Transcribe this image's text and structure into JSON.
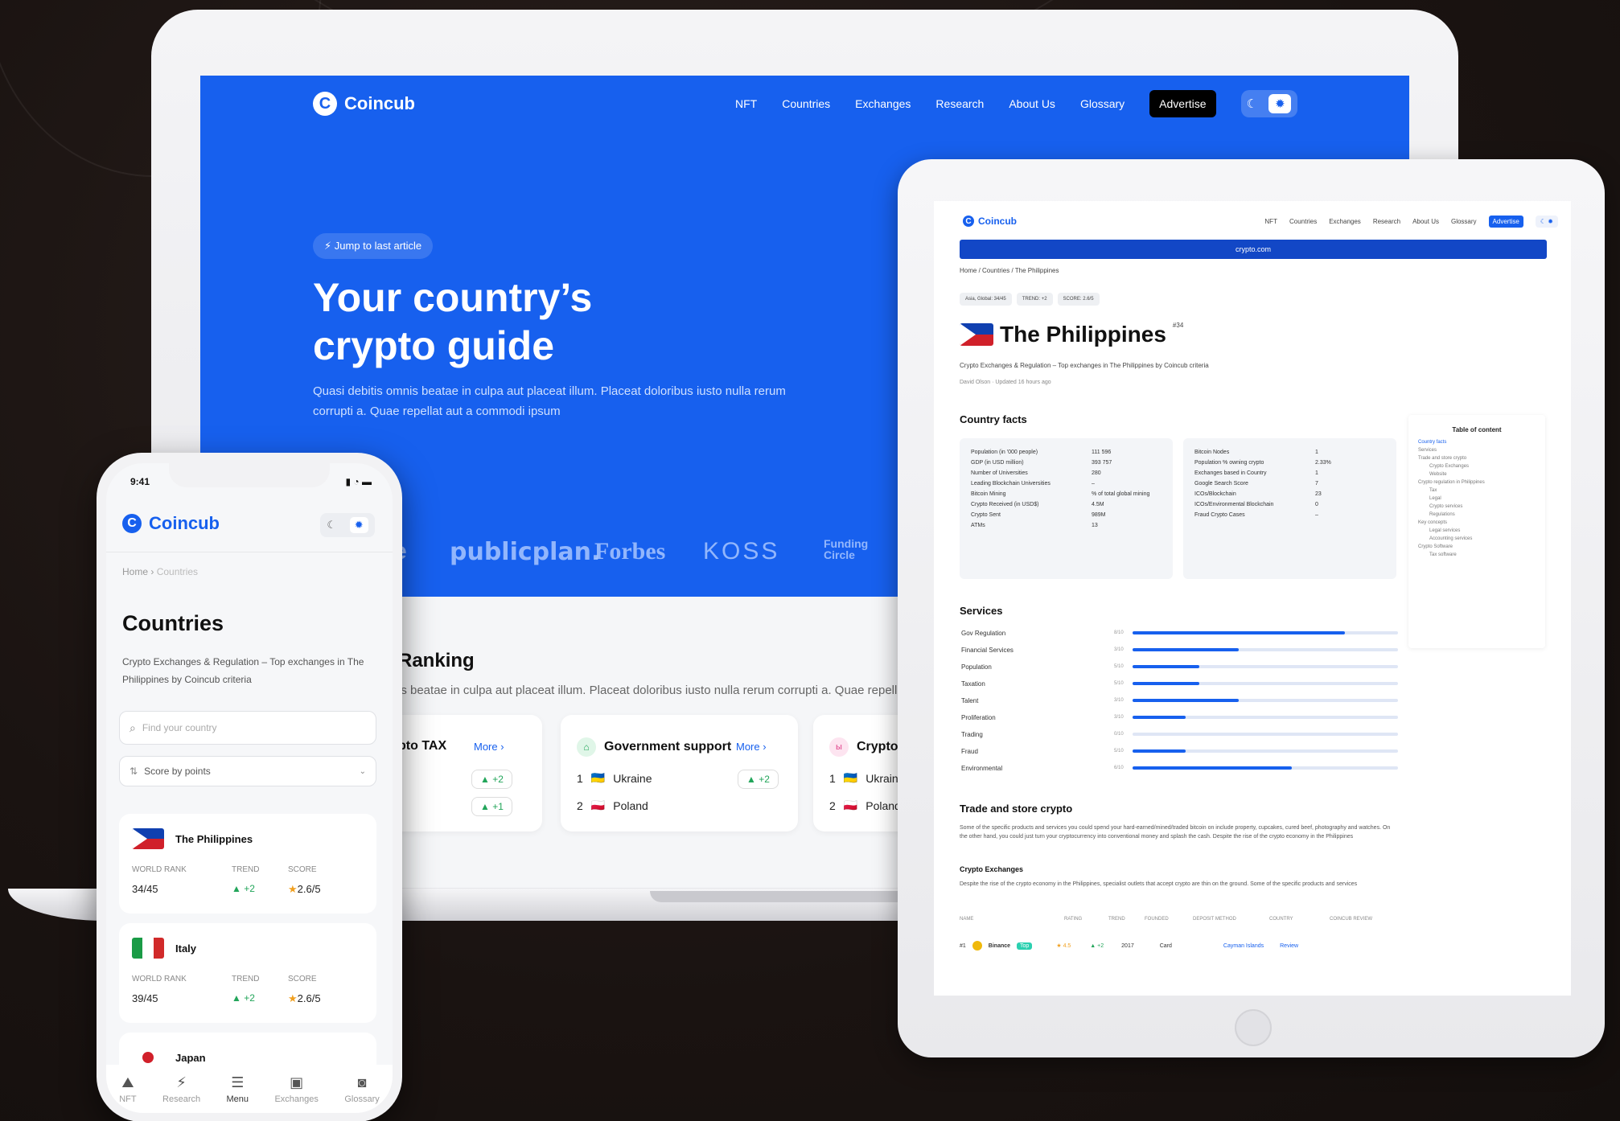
{
  "colors": {
    "brand_blue": "#1760ee",
    "background": "#1c1513",
    "up": "#22a55a",
    "star": "#f0a020"
  },
  "laptop": {
    "logo": "Coincub",
    "nav": [
      "NFT",
      "Countries",
      "Exchanges",
      "Research",
      "About Us",
      "Glossary"
    ],
    "advertise": "Advertise",
    "jump_chip": "Jump to last article",
    "headline": "Your country’s crypto guide",
    "lead": "Quasi debitis omnis beatae in culpa aut placeat illum. Placeat doloribus iusto nulla rerum corrupti a. Quae repellat aut a commodi ipsum",
    "brands": [
      "e",
      "publicplan.",
      "Forbes",
      "KOSS",
      "Funding Circle"
    ],
    "ranking_title": "Ranking",
    "ranking_sub": "is beatae in culpa aut placeat illum. Placeat doloribus iusto nulla rerum corrupti a. Quae repellat",
    "cards": [
      {
        "title": "pto TAX",
        "more": "More",
        "rows": [
          {
            "change": "+2"
          },
          {
            "change": "+1"
          }
        ]
      },
      {
        "title": "Government support",
        "more": "More",
        "rows": [
          {
            "rank": "1",
            "country": "Ukraine",
            "change": "+2"
          },
          {
            "rank": "2",
            "country": "Poland"
          }
        ]
      },
      {
        "title": "Crypto",
        "rows": [
          {
            "rank": "1",
            "country": "Ukrain"
          },
          {
            "rank": "2",
            "country": "Poland"
          }
        ]
      }
    ]
  },
  "tablet": {
    "logo": "Coincub",
    "nav": [
      "NFT",
      "Countries",
      "Exchanges",
      "Research",
      "About Us",
      "Glossary"
    ],
    "advertise": "Advertise",
    "banner": "crypto.com",
    "breadcrumb": "Home / Countries / The Philippines",
    "tags": [
      "Asia, Global: 34/45",
      "TREND: +2",
      "SCORE: 2.6/5"
    ],
    "title": "The Philippines",
    "rank": "#34",
    "subtitle": "Crypto Exchanges & Regulation – Top exchanges in The Philippines by Coincub criteria",
    "author": "David Olson · Updated 16 hours ago",
    "country_facts": "Country facts",
    "facts_left": [
      [
        "Population (in '000 people)",
        "111 596"
      ],
      [
        "GDP (in USD million)",
        "393 757"
      ],
      [
        "Number of Universities",
        "280"
      ],
      [
        "Leading Blockchain Universities",
        "–"
      ],
      [
        "Bitcoin Mining",
        "% of total global mining"
      ],
      [
        "Crypto Received (in USD$)",
        "4.5M"
      ],
      [
        "Crypto Sent",
        "989M"
      ],
      [
        "ATMs",
        "13"
      ]
    ],
    "facts_right": [
      [
        "Bitcoin Nodes",
        "1"
      ],
      [
        "Population % owning crypto",
        "2.33%"
      ],
      [
        "Exchanges based in Country",
        "1"
      ],
      [
        "Google Search Score",
        "7"
      ],
      [
        "ICOs/Blockchain",
        "23"
      ],
      [
        "ICOs/Environmental Blockchain",
        "0"
      ],
      [
        "Fraud Crypto Cases",
        "–"
      ]
    ],
    "services_title": "Services",
    "services": [
      {
        "name": "Gov Regulation",
        "score": "8/10",
        "value": 0.8
      },
      {
        "name": "Financial Services",
        "score": "3/10",
        "value": 0.4
      },
      {
        "name": "Population",
        "score": "5/10",
        "value": 0.25
      },
      {
        "name": "Taxation",
        "score": "5/10",
        "value": 0.25
      },
      {
        "name": "Talent",
        "score": "3/10",
        "value": 0.4
      },
      {
        "name": "Proliferation",
        "score": "3/10",
        "value": 0.2
      },
      {
        "name": "Trading",
        "score": "0/10",
        "value": 0
      },
      {
        "name": "Fraud",
        "score": "5/10",
        "value": 0.2
      },
      {
        "name": "Environmental",
        "score": "6/10",
        "value": 0.6
      }
    ],
    "toc_title": "Table of content",
    "toc": [
      "Country facts",
      "Services",
      "Trade and store crypto",
      "Crypto Exchanges",
      "Website",
      "Crypto regulation in Philippines",
      "Tax",
      "Legal",
      "Crypto services",
      "Regulations",
      "Key concepts",
      "Legal services",
      "Accounting services",
      "Crypto Software",
      "Tax software"
    ],
    "trade_title": "Trade and store crypto",
    "trade_text": "Some of the specific products and services you could spend your hard-earned/mined/traded bitcoin on include property, cupcakes, cured beef, photography and watches. On the other hand, you could just turn your cryptocurrency into conventional money and splash the cash. Despite the rise of the crypto economy in the Philippines",
    "exchanges_title": "Crypto Exchanges",
    "exchanges_text": "Despite the rise of the crypto economy in the Philippines, specialist outlets that accept crypto are thin on the ground. Some of the specific products and services",
    "table_head": [
      "NAME",
      "RATING",
      "TREND",
      "FOUNDED",
      "DEPOSIT METHOD",
      "COUNTRY",
      "COINCUB REVIEW"
    ],
    "table_row": [
      "#1",
      "Binance",
      "Top",
      "4.5",
      "+2",
      "2017",
      "Card",
      "Cayman Islands",
      "Review"
    ]
  },
  "phone": {
    "time": "9:41",
    "logo": "Coincub",
    "breadcrumb_home": "Home",
    "breadcrumb_current": "Countries",
    "title": "Countries",
    "subtitle": "Crypto Exchanges & Regulation – Top exchanges in The Philippines by Coincub criteria",
    "search_placeholder": "Find your country",
    "sort_label": "Score by points",
    "labels": {
      "rank": "WORLD RANK",
      "trend": "TREND",
      "score": "SCORE"
    },
    "countries": [
      {
        "name": "The Philippines",
        "rank": "34/45",
        "trend": "+2",
        "score": "2.6/5"
      },
      {
        "name": "Italy",
        "rank": "39/45",
        "trend": "+2",
        "score": "2.6/5"
      },
      {
        "name": "Japan"
      }
    ],
    "tabs": [
      "NFT",
      "Research",
      "Menu",
      "Exchanges",
      "Glossary"
    ]
  }
}
